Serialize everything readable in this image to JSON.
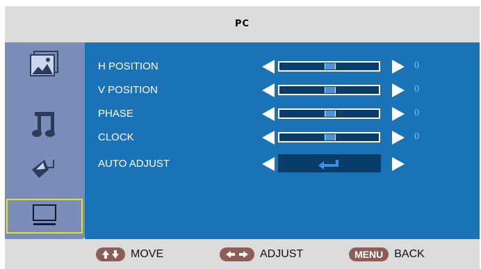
{
  "header": {
    "title": "PC"
  },
  "sidebar": {
    "items": [
      {
        "icon": "picture-icon",
        "selected": false
      },
      {
        "icon": "music-note-icon",
        "selected": false
      },
      {
        "icon": "pen-setup-icon",
        "selected": false
      },
      {
        "icon": "monitor-pc-icon",
        "selected": true
      }
    ]
  },
  "menu": {
    "rows": [
      {
        "label": "H POSITION",
        "value": "0",
        "level_percent": 50
      },
      {
        "label": "V POSITION",
        "value": "0",
        "level_percent": 50
      },
      {
        "label": "PHASE",
        "value": "0",
        "level_percent": 50
      },
      {
        "label": "CLOCK",
        "value": "0",
        "level_percent": 50
      },
      {
        "label": "AUTO ADJUST",
        "action_icon": "enter-icon"
      }
    ]
  },
  "footer": {
    "move": {
      "key_icon": "up-down-arrows-icon",
      "label": "MOVE"
    },
    "adjust": {
      "key_icon": "left-right-arrows-icon",
      "label": "ADJUST"
    },
    "back": {
      "key": "MENU",
      "label": "BACK"
    }
  },
  "colors": {
    "content_bg": "#1a73b6",
    "sidebar_bg": "#7a8db9",
    "highlight": "#e8e414",
    "value_text": "#8ec0ea",
    "key_bg": "#8d5d55"
  }
}
